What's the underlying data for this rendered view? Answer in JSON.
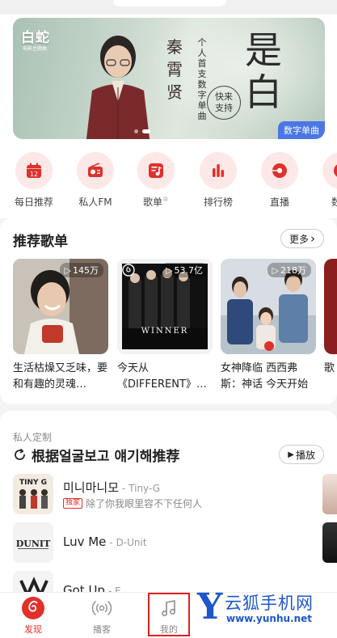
{
  "banner": {
    "logo": "白蛇",
    "logo_sub": "电影主题曲",
    "artist": "秦霄贤",
    "description": "个人首支数字单曲",
    "title_art": "是白",
    "support": "快来支持",
    "tag": "数字单曲",
    "slide_count": 2,
    "active_slide": 1
  },
  "quick_entries": [
    {
      "label": "每日推荐",
      "icon": "calendar-icon",
      "calendar_day": "12"
    },
    {
      "label": "私人FM",
      "icon": "radio-icon"
    },
    {
      "label": "歌单",
      "icon": "playlist-icon",
      "superscript": "®"
    },
    {
      "label": "排行榜",
      "icon": "chart-icon"
    },
    {
      "label": "直播",
      "icon": "live-icon"
    },
    {
      "label": "数字",
      "icon": "album-icon"
    }
  ],
  "recommended": {
    "title": "推荐歌单",
    "more_label": "更多",
    "more_chevron": "›",
    "playlists": [
      {
        "plays": "145万",
        "name": "生活枯燥又乏味，要和有趣的灵魂…"
      },
      {
        "plays": "53.7亿",
        "name": "今天从《DIFFERENT》…",
        "cover_text": "WINNER"
      },
      {
        "plays": "218万",
        "name": "女神降临 西西弗斯：神话 今天开始契…"
      },
      {
        "plays": "",
        "name": "歌"
      }
    ]
  },
  "personal": {
    "caption": "私人定制",
    "title": "根据얼굴보고 얘기해推荐",
    "play_label": "播放",
    "songs": [
      {
        "title": "미니마니모",
        "artist": "- Tiny-G",
        "badge": "独家",
        "subtitle": "除了你我眼里容不下任何人",
        "cover_text": "TINY G"
      },
      {
        "title": "Luv Me",
        "artist": "- D-Unit",
        "badge": "",
        "subtitle": "",
        "cover_text": "DUNIT"
      },
      {
        "title": "Got Up",
        "artist": "- E…",
        "badge": "",
        "subtitle": "",
        "cover_text": ""
      }
    ]
  },
  "tabbar": {
    "tabs": [
      {
        "label": "发现",
        "icon": "netease-logo-icon",
        "active": true
      },
      {
        "label": "播客",
        "icon": "podcast-icon",
        "active": false
      },
      {
        "label": "我的",
        "icon": "music-note-icon",
        "active": false
      }
    ]
  },
  "watermark": {
    "letter": "Y",
    "name": "云狐手机网",
    "url": "www.yunhu.net"
  },
  "colors": {
    "accent": "#e0302a",
    "icon_bg": "#fde8e8",
    "tag_blue": "#4a77e5",
    "watermark_blue": "#1d57c9",
    "highlight_box": "#e02020"
  }
}
